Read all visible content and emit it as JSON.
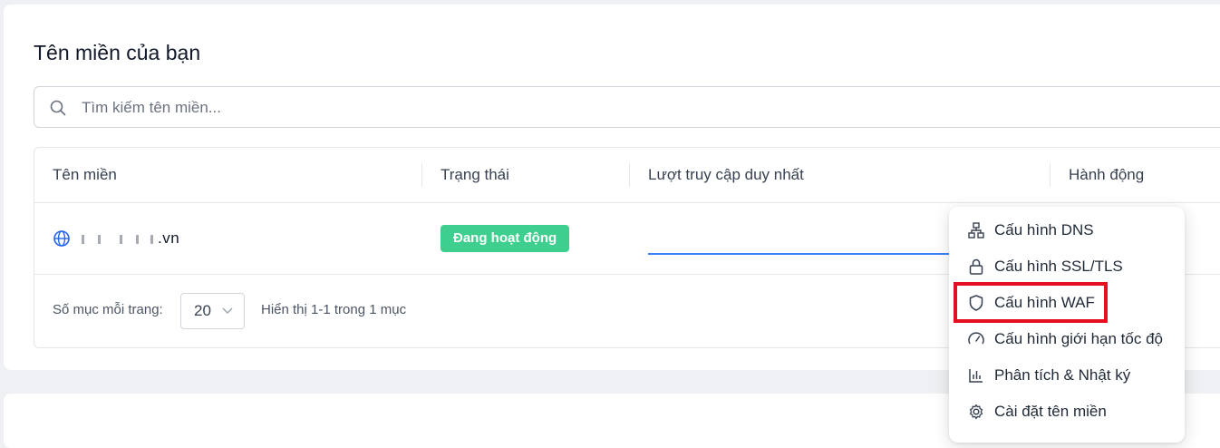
{
  "header": {
    "title": "Tên miền của bạn"
  },
  "search": {
    "placeholder": "Tìm kiếm tên miền..."
  },
  "table": {
    "columns": [
      "Tên miền",
      "Trạng thái",
      "Lượt truy cập duy nhất",
      "Hành động"
    ],
    "rows": [
      {
        "domain_suffix": ".vn",
        "status": "Đang hoạt động"
      }
    ]
  },
  "footer": {
    "per_page_label": "Số mục mỗi trang:",
    "per_page_value": "20",
    "pagination_info": "Hiển thị 1-1 trong 1 mục"
  },
  "action_menu": {
    "items": [
      {
        "label": "Cấu hình DNS",
        "icon": "network-icon"
      },
      {
        "label": "Cấu hình SSL/TLS",
        "icon": "lock-icon"
      },
      {
        "label": "Cấu hình WAF",
        "icon": "shield-icon"
      },
      {
        "label": "Cấu hình giới hạn tốc độ",
        "icon": "gauge-icon"
      },
      {
        "label": "Phân tích & Nhật ký",
        "icon": "bar-chart-icon"
      },
      {
        "label": "Cài đặt tên miền",
        "icon": "gear-icon"
      }
    ]
  },
  "colors": {
    "status_active": "#3ecf8e",
    "accent_blue": "#3b82f6",
    "highlight_red": "#e3101f"
  }
}
